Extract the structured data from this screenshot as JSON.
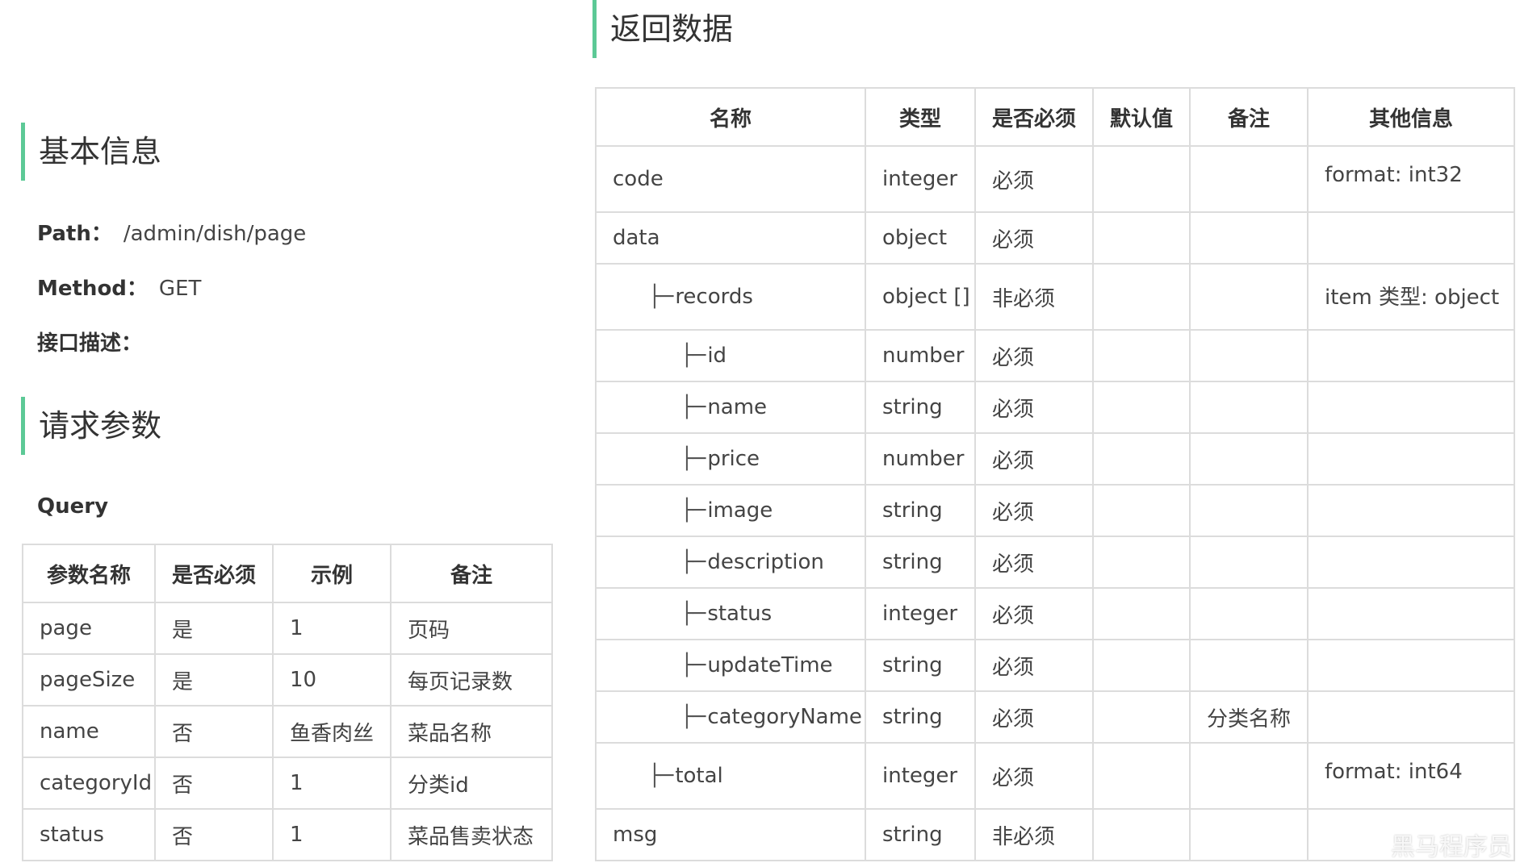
{
  "basic": {
    "heading": "基本信息",
    "path_label": "Path：",
    "path_value": "/admin/dish/page",
    "method_label": "Method：",
    "method_value": "GET",
    "desc_label": "接口描述："
  },
  "request": {
    "heading": "请求参数",
    "query_label": "Query",
    "columns": [
      "参数名称",
      "是否必须",
      "示例",
      "备注"
    ],
    "rows": [
      [
        "page",
        "是",
        "1",
        "页码"
      ],
      [
        "pageSize",
        "是",
        "10",
        "每页记录数"
      ],
      [
        "name",
        "否",
        "鱼香肉丝",
        "菜品名称"
      ],
      [
        "categoryId",
        "否",
        "1",
        "分类id"
      ],
      [
        "status",
        "否",
        "1",
        "菜品售卖状态"
      ]
    ]
  },
  "response": {
    "heading": "返回数据",
    "columns": [
      "名称",
      "类型",
      "是否必须",
      "默认值",
      "备注",
      "其他信息"
    ],
    "tree_glyph": "├─",
    "rows": [
      {
        "name": "code",
        "type": "integer",
        "required": "必须",
        "default": "",
        "remark": "",
        "other": "format: int32"
      },
      {
        "name": "data",
        "type": "object",
        "required": "必须",
        "default": "",
        "remark": "",
        "other": ""
      },
      {
        "name": "records",
        "type": "object []",
        "required": "非必须",
        "default": "",
        "remark": "",
        "other": "item 类型: object"
      },
      {
        "name": "id",
        "type": "number",
        "required": "必须",
        "default": "",
        "remark": "",
        "other": ""
      },
      {
        "name": "name",
        "type": "string",
        "required": "必须",
        "default": "",
        "remark": "",
        "other": ""
      },
      {
        "name": "price",
        "type": "number",
        "required": "必须",
        "default": "",
        "remark": "",
        "other": ""
      },
      {
        "name": "image",
        "type": "string",
        "required": "必须",
        "default": "",
        "remark": "",
        "other": ""
      },
      {
        "name": "description",
        "type": "string",
        "required": "必须",
        "default": "",
        "remark": "",
        "other": ""
      },
      {
        "name": "status",
        "type": "integer",
        "required": "必须",
        "default": "",
        "remark": "",
        "other": ""
      },
      {
        "name": "updateTime",
        "type": "string",
        "required": "必须",
        "default": "",
        "remark": "",
        "other": ""
      },
      {
        "name": "categoryName",
        "type": "string",
        "required": "必须",
        "default": "",
        "remark": "分类名称",
        "other": ""
      },
      {
        "name": "total",
        "type": "integer",
        "required": "必须",
        "default": "",
        "remark": "",
        "other": "format: int64"
      },
      {
        "name": "msg",
        "type": "string",
        "required": "非必须",
        "default": "",
        "remark": "",
        "other": ""
      }
    ]
  },
  "watermark": "黑马程序员"
}
